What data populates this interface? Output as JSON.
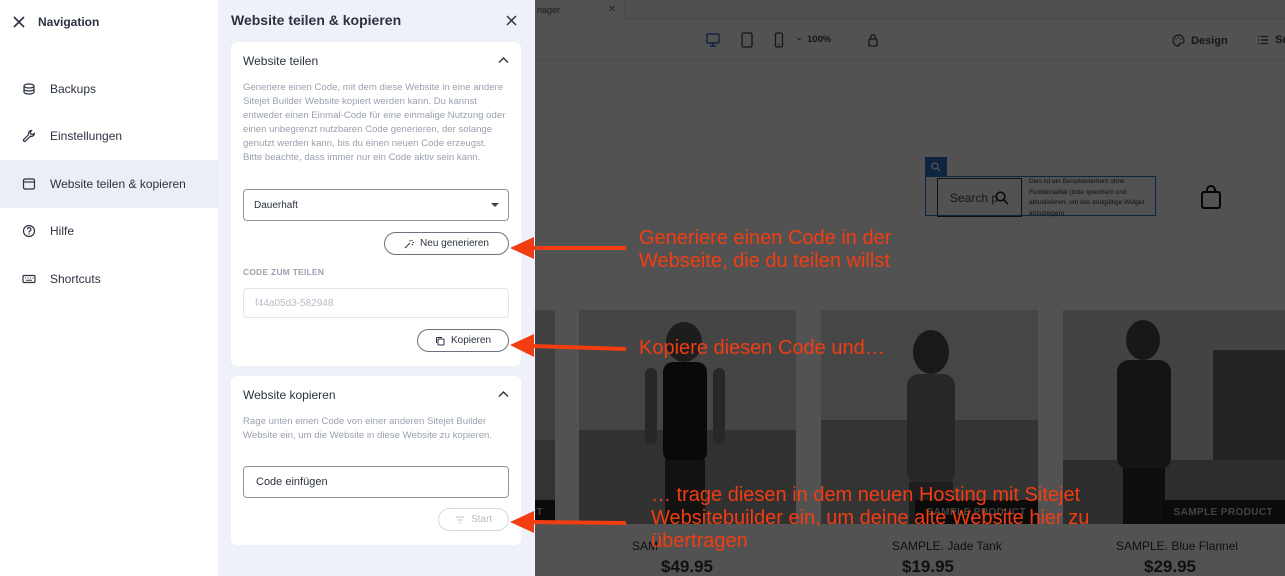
{
  "nav": {
    "title": "Navigation",
    "items": [
      {
        "label": "Backups",
        "icon": "backup-icon"
      },
      {
        "label": "Einstellungen",
        "icon": "wrench-icon"
      },
      {
        "label": "Website teilen & kopieren",
        "icon": "window-icon"
      },
      {
        "label": "Hilfe",
        "icon": "help-icon"
      },
      {
        "label": "Shortcuts",
        "icon": "keyboard-icon"
      }
    ],
    "active_index": 2
  },
  "panel": {
    "title": "Website teilen & kopieren",
    "share": {
      "title": "Website teilen",
      "description": "Generiere einen Code, mit dem diese Website in eine andere Sitejet Builder Website kopiert werden kann. Du kannst entweder einen Einmal-Code für eine einmalige Nutzung oder einen unbegrenzt nutzbaren Code generieren, der solange genutzt werden kann, bis du einen neuen Code erzeugst. Bitte beachte, dass immer nur ein Code aktiv sein kann.",
      "select_value": "Dauerhaft",
      "regenerate_label": "Neu generieren",
      "code_label": "CODE ZUM TEILEN",
      "code_value": "f44a05d3-582948",
      "copy_label": "Kopieren"
    },
    "copy": {
      "title": "Website kopieren",
      "description": "Rage unten einen Code von einer anderen Sitejet Builder Website ein, um die Website in diese Website zu kopieren.",
      "input_placeholder": "Code einfügen",
      "start_label": "Start"
    }
  },
  "editor": {
    "tab_label": "nager",
    "zoom": "100%",
    "design_label": "Design",
    "se_label": "Se",
    "search_placeholder": "Search p",
    "widget_note": "Dies ist ein Beispielelement ohne Funktionalität (bitte speichern und aktualisieren, um das endgültige Widget anzuzeigen)",
    "products": [
      {
        "tag": "SAMPLE PRODUCT",
        "name": "SAMPLE. Jade Tank",
        "price": "$19.95"
      },
      {
        "tag": "SAMPLE PRODUCT",
        "name": "SAMPLE. Blue Flannel",
        "price": "$29.95"
      }
    ],
    "partial_product": {
      "tag": "SAMPLE PRODUCT",
      "name": "SAM",
      "price": "$49.95"
    }
  },
  "annotations": [
    "Generiere einen Code in der Webseite, die du teilen willst",
    "Kopiere diesen Code und…",
    "… trage diesen in dem neuen Hosting mit Sitejet Websitebuilder ein, um deine alte Website hier zu übertragen"
  ],
  "colors": {
    "annotation": "#f23d12",
    "accent": "#2e74c4",
    "active_nav": "#ebeef5"
  }
}
